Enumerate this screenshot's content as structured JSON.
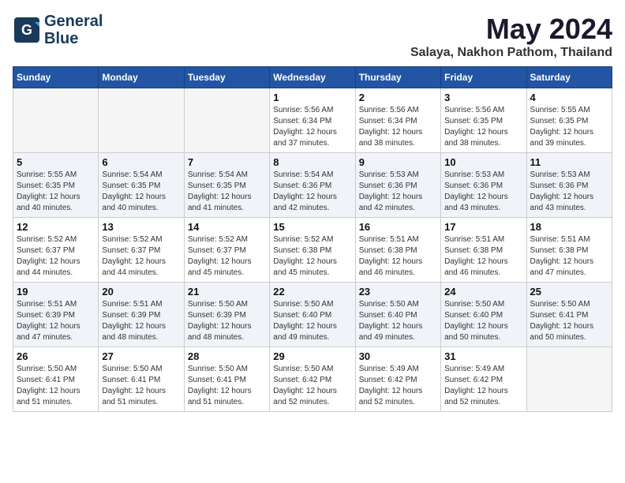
{
  "logo": {
    "line1": "General",
    "line2": "Blue"
  },
  "title": "May 2024",
  "location": "Salaya, Nakhon Pathom, Thailand",
  "days_of_week": [
    "Sunday",
    "Monday",
    "Tuesday",
    "Wednesday",
    "Thursday",
    "Friday",
    "Saturday"
  ],
  "weeks": [
    [
      {
        "day": "",
        "sunrise": "",
        "sunset": "",
        "daylight": ""
      },
      {
        "day": "",
        "sunrise": "",
        "sunset": "",
        "daylight": ""
      },
      {
        "day": "",
        "sunrise": "",
        "sunset": "",
        "daylight": ""
      },
      {
        "day": "1",
        "sunrise": "Sunrise: 5:56 AM",
        "sunset": "Sunset: 6:34 PM",
        "daylight": "Daylight: 12 hours and 37 minutes."
      },
      {
        "day": "2",
        "sunrise": "Sunrise: 5:56 AM",
        "sunset": "Sunset: 6:34 PM",
        "daylight": "Daylight: 12 hours and 38 minutes."
      },
      {
        "day": "3",
        "sunrise": "Sunrise: 5:56 AM",
        "sunset": "Sunset: 6:35 PM",
        "daylight": "Daylight: 12 hours and 38 minutes."
      },
      {
        "day": "4",
        "sunrise": "Sunrise: 5:55 AM",
        "sunset": "Sunset: 6:35 PM",
        "daylight": "Daylight: 12 hours and 39 minutes."
      }
    ],
    [
      {
        "day": "5",
        "sunrise": "Sunrise: 5:55 AM",
        "sunset": "Sunset: 6:35 PM",
        "daylight": "Daylight: 12 hours and 40 minutes."
      },
      {
        "day": "6",
        "sunrise": "Sunrise: 5:54 AM",
        "sunset": "Sunset: 6:35 PM",
        "daylight": "Daylight: 12 hours and 40 minutes."
      },
      {
        "day": "7",
        "sunrise": "Sunrise: 5:54 AM",
        "sunset": "Sunset: 6:35 PM",
        "daylight": "Daylight: 12 hours and 41 minutes."
      },
      {
        "day": "8",
        "sunrise": "Sunrise: 5:54 AM",
        "sunset": "Sunset: 6:36 PM",
        "daylight": "Daylight: 12 hours and 42 minutes."
      },
      {
        "day": "9",
        "sunrise": "Sunrise: 5:53 AM",
        "sunset": "Sunset: 6:36 PM",
        "daylight": "Daylight: 12 hours and 42 minutes."
      },
      {
        "day": "10",
        "sunrise": "Sunrise: 5:53 AM",
        "sunset": "Sunset: 6:36 PM",
        "daylight": "Daylight: 12 hours and 43 minutes."
      },
      {
        "day": "11",
        "sunrise": "Sunrise: 5:53 AM",
        "sunset": "Sunset: 6:36 PM",
        "daylight": "Daylight: 12 hours and 43 minutes."
      }
    ],
    [
      {
        "day": "12",
        "sunrise": "Sunrise: 5:52 AM",
        "sunset": "Sunset: 6:37 PM",
        "daylight": "Daylight: 12 hours and 44 minutes."
      },
      {
        "day": "13",
        "sunrise": "Sunrise: 5:52 AM",
        "sunset": "Sunset: 6:37 PM",
        "daylight": "Daylight: 12 hours and 44 minutes."
      },
      {
        "day": "14",
        "sunrise": "Sunrise: 5:52 AM",
        "sunset": "Sunset: 6:37 PM",
        "daylight": "Daylight: 12 hours and 45 minutes."
      },
      {
        "day": "15",
        "sunrise": "Sunrise: 5:52 AM",
        "sunset": "Sunset: 6:38 PM",
        "daylight": "Daylight: 12 hours and 45 minutes."
      },
      {
        "day": "16",
        "sunrise": "Sunrise: 5:51 AM",
        "sunset": "Sunset: 6:38 PM",
        "daylight": "Daylight: 12 hours and 46 minutes."
      },
      {
        "day": "17",
        "sunrise": "Sunrise: 5:51 AM",
        "sunset": "Sunset: 6:38 PM",
        "daylight": "Daylight: 12 hours and 46 minutes."
      },
      {
        "day": "18",
        "sunrise": "Sunrise: 5:51 AM",
        "sunset": "Sunset: 6:38 PM",
        "daylight": "Daylight: 12 hours and 47 minutes."
      }
    ],
    [
      {
        "day": "19",
        "sunrise": "Sunrise: 5:51 AM",
        "sunset": "Sunset: 6:39 PM",
        "daylight": "Daylight: 12 hours and 47 minutes."
      },
      {
        "day": "20",
        "sunrise": "Sunrise: 5:51 AM",
        "sunset": "Sunset: 6:39 PM",
        "daylight": "Daylight: 12 hours and 48 minutes."
      },
      {
        "day": "21",
        "sunrise": "Sunrise: 5:50 AM",
        "sunset": "Sunset: 6:39 PM",
        "daylight": "Daylight: 12 hours and 48 minutes."
      },
      {
        "day": "22",
        "sunrise": "Sunrise: 5:50 AM",
        "sunset": "Sunset: 6:40 PM",
        "daylight": "Daylight: 12 hours and 49 minutes."
      },
      {
        "day": "23",
        "sunrise": "Sunrise: 5:50 AM",
        "sunset": "Sunset: 6:40 PM",
        "daylight": "Daylight: 12 hours and 49 minutes."
      },
      {
        "day": "24",
        "sunrise": "Sunrise: 5:50 AM",
        "sunset": "Sunset: 6:40 PM",
        "daylight": "Daylight: 12 hours and 50 minutes."
      },
      {
        "day": "25",
        "sunrise": "Sunrise: 5:50 AM",
        "sunset": "Sunset: 6:41 PM",
        "daylight": "Daylight: 12 hours and 50 minutes."
      }
    ],
    [
      {
        "day": "26",
        "sunrise": "Sunrise: 5:50 AM",
        "sunset": "Sunset: 6:41 PM",
        "daylight": "Daylight: 12 hours and 51 minutes."
      },
      {
        "day": "27",
        "sunrise": "Sunrise: 5:50 AM",
        "sunset": "Sunset: 6:41 PM",
        "daylight": "Daylight: 12 hours and 51 minutes."
      },
      {
        "day": "28",
        "sunrise": "Sunrise: 5:50 AM",
        "sunset": "Sunset: 6:41 PM",
        "daylight": "Daylight: 12 hours and 51 minutes."
      },
      {
        "day": "29",
        "sunrise": "Sunrise: 5:50 AM",
        "sunset": "Sunset: 6:42 PM",
        "daylight": "Daylight: 12 hours and 52 minutes."
      },
      {
        "day": "30",
        "sunrise": "Sunrise: 5:49 AM",
        "sunset": "Sunset: 6:42 PM",
        "daylight": "Daylight: 12 hours and 52 minutes."
      },
      {
        "day": "31",
        "sunrise": "Sunrise: 5:49 AM",
        "sunset": "Sunset: 6:42 PM",
        "daylight": "Daylight: 12 hours and 52 minutes."
      },
      {
        "day": "",
        "sunrise": "",
        "sunset": "",
        "daylight": ""
      }
    ]
  ]
}
